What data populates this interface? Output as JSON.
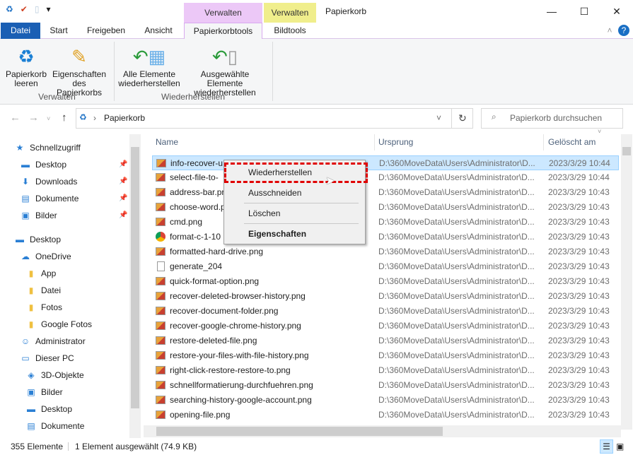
{
  "window": {
    "title": "Papierkorb",
    "context_tabs": [
      "Verwalten",
      "Verwalten"
    ]
  },
  "tabs": [
    "Datei",
    "Start",
    "Freigeben",
    "Ansicht",
    "Papierkorbtools",
    "Bildtools"
  ],
  "ribbon": {
    "buttons": [
      {
        "line1": "Papierkorb",
        "line2": "leeren"
      },
      {
        "line1": "Eigenschaften",
        "line2": "des Papierkorbs"
      },
      {
        "line1": "Alle Elemente",
        "line2": "wiederherstellen"
      },
      {
        "line1": "Ausgewählte Elemente",
        "line2": "wiederherstellen"
      }
    ],
    "groups": [
      "Verwalten",
      "Wiederherstellen"
    ]
  },
  "address": {
    "path": "Papierkorb",
    "search_placeholder": "Papierkorb durchsuchen"
  },
  "sidebar": [
    {
      "label": "Schnellzugriff",
      "icon": "★",
      "pinned": false
    },
    {
      "label": "Desktop",
      "icon": "▬",
      "pinned": true
    },
    {
      "label": "Downloads",
      "icon": "⬇",
      "pinned": true
    },
    {
      "label": "Dokumente",
      "icon": "▤",
      "pinned": true
    },
    {
      "label": "Bilder",
      "icon": "▣",
      "pinned": true
    },
    {
      "label": "Desktop",
      "icon": "▬",
      "pinned": false
    },
    {
      "label": "OneDrive",
      "icon": "☁",
      "pinned": false
    },
    {
      "label": "App",
      "icon": "▮",
      "pinned": false
    },
    {
      "label": "Datei",
      "icon": "▮",
      "pinned": false
    },
    {
      "label": "Fotos",
      "icon": "▮",
      "pinned": false
    },
    {
      "label": "Google Fotos",
      "icon": "▮",
      "pinned": false
    },
    {
      "label": "Administrator",
      "icon": "☺",
      "pinned": false
    },
    {
      "label": "Dieser PC",
      "icon": "▭",
      "pinned": false
    },
    {
      "label": "3D-Objekte",
      "icon": "◈",
      "pinned": false
    },
    {
      "label": "Bilder",
      "icon": "▣",
      "pinned": false
    },
    {
      "label": "Desktop",
      "icon": "▬",
      "pinned": false
    },
    {
      "label": "Dokumente",
      "icon": "▤",
      "pinned": false
    }
  ],
  "columns": [
    "Name",
    "Ursprung",
    "Gelöscht am"
  ],
  "files": [
    {
      "name": "info-recover-u",
      "origin": "D:\\360MoveData\\Users\\Administrator\\D...",
      "date": "2023/3/29 10:44",
      "type": "img"
    },
    {
      "name": "select-file-to-",
      "origin": "D:\\360MoveData\\Users\\Administrator\\D...",
      "date": "2023/3/29 10:44",
      "type": "img"
    },
    {
      "name": "address-bar.pr",
      "origin": "D:\\360MoveData\\Users\\Administrator\\D...",
      "date": "2023/3/29 10:43",
      "type": "img"
    },
    {
      "name": "choose-word.p",
      "origin": "D:\\360MoveData\\Users\\Administrator\\D...",
      "date": "2023/3/29 10:43",
      "type": "img"
    },
    {
      "name": "cmd.png",
      "origin": "D:\\360MoveData\\Users\\Administrator\\D...",
      "date": "2023/3/29 10:43",
      "type": "img"
    },
    {
      "name": "format-c-1-10",
      "origin": "D:\\360MoveData\\Users\\Administrator\\D...",
      "date": "2023/3/29 10:43",
      "type": "chrome"
    },
    {
      "name": "formatted-hard-drive.png",
      "origin": "D:\\360MoveData\\Users\\Administrator\\D...",
      "date": "2023/3/29 10:43",
      "type": "img"
    },
    {
      "name": "generate_204",
      "origin": "D:\\360MoveData\\Users\\Administrator\\D...",
      "date": "2023/3/29 10:43",
      "type": "doc"
    },
    {
      "name": "quick-format-option.png",
      "origin": "D:\\360MoveData\\Users\\Administrator\\D...",
      "date": "2023/3/29 10:43",
      "type": "img"
    },
    {
      "name": "recover-deleted-browser-history.png",
      "origin": "D:\\360MoveData\\Users\\Administrator\\D...",
      "date": "2023/3/29 10:43",
      "type": "img"
    },
    {
      "name": "recover-document-folder.png",
      "origin": "D:\\360MoveData\\Users\\Administrator\\D...",
      "date": "2023/3/29 10:43",
      "type": "img"
    },
    {
      "name": "recover-google-chrome-history.png",
      "origin": "D:\\360MoveData\\Users\\Administrator\\D...",
      "date": "2023/3/29 10:43",
      "type": "img"
    },
    {
      "name": "restore-deleted-file.png",
      "origin": "D:\\360MoveData\\Users\\Administrator\\D...",
      "date": "2023/3/29 10:43",
      "type": "img"
    },
    {
      "name": "restore-your-files-with-file-history.png",
      "origin": "D:\\360MoveData\\Users\\Administrator\\D...",
      "date": "2023/3/29 10:43",
      "type": "img"
    },
    {
      "name": "right-click-restore-restore-to.png",
      "origin": "D:\\360MoveData\\Users\\Administrator\\D...",
      "date": "2023/3/29 10:43",
      "type": "img"
    },
    {
      "name": "schnellformatierung-durchfuehren.png",
      "origin": "D:\\360MoveData\\Users\\Administrator\\D...",
      "date": "2023/3/29 10:43",
      "type": "img"
    },
    {
      "name": "searching-history-google-account.png",
      "origin": "D:\\360MoveData\\Users\\Administrator\\D...",
      "date": "2023/3/29 10:43",
      "type": "img"
    },
    {
      "name": "opening-file.png",
      "origin": "D:\\360MoveData\\Users\\Administrator\\D...",
      "date": "2023/3/29 10:43",
      "type": "img"
    }
  ],
  "context_menu": [
    "Wiederherstellen",
    "Ausschneiden",
    "Löschen",
    "Eigenschaften"
  ],
  "status": {
    "count": "355 Elemente",
    "selection": "1 Element ausgewählt (74.9 KB)"
  }
}
